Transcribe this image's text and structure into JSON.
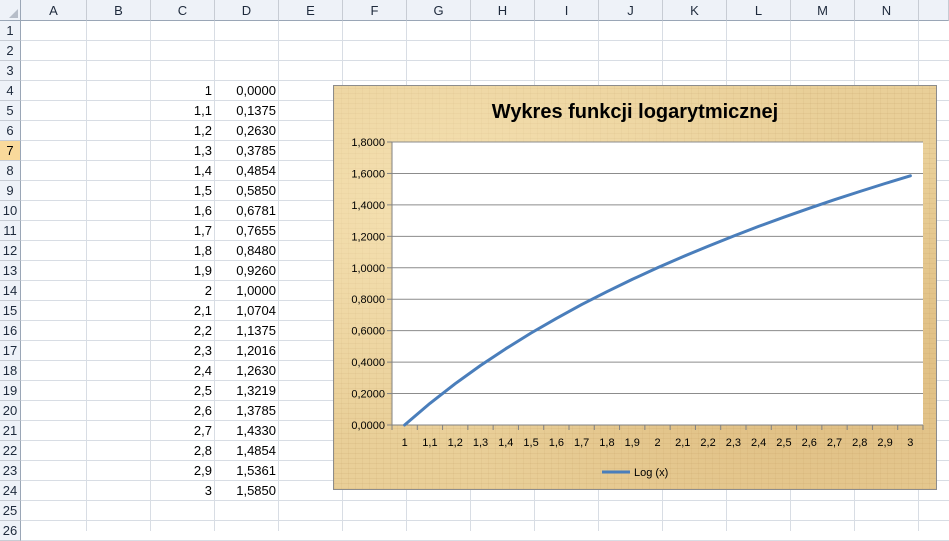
{
  "columns": [
    "A",
    "B",
    "C",
    "D",
    "E",
    "F",
    "G",
    "H",
    "I",
    "J",
    "K",
    "L",
    "M",
    "N"
  ],
  "rows": [
    "1",
    "2",
    "3",
    "4",
    "5",
    "6",
    "7",
    "8",
    "9",
    "10",
    "11",
    "12",
    "13",
    "14",
    "15",
    "16",
    "17",
    "18",
    "19",
    "20",
    "21",
    "22",
    "23",
    "24",
    "25",
    "26"
  ],
  "active_row": "7",
  "table": {
    "c": [
      "1",
      "1,1",
      "1,2",
      "1,3",
      "1,4",
      "1,5",
      "1,6",
      "1,7",
      "1,8",
      "1,9",
      "2",
      "2,1",
      "2,2",
      "2,3",
      "2,4",
      "2,5",
      "2,6",
      "2,7",
      "2,8",
      "2,9",
      "3"
    ],
    "d": [
      "0,0000",
      "0,1375",
      "0,2630",
      "0,3785",
      "0,4854",
      "0,5850",
      "0,6781",
      "0,7655",
      "0,8480",
      "0,9260",
      "1,0000",
      "1,0704",
      "1,1375",
      "1,2016",
      "1,2630",
      "1,3219",
      "1,3785",
      "1,4330",
      "1,4854",
      "1,5361",
      "1,5850"
    ]
  },
  "chart_data": {
    "type": "line",
    "title": "Wykres funkcji logarytmicznej",
    "categories": [
      "1",
      "1,1",
      "1,2",
      "1,3",
      "1,4",
      "1,5",
      "1,6",
      "1,7",
      "1,8",
      "1,9",
      "2",
      "2,1",
      "2,2",
      "2,3",
      "2,4",
      "2,5",
      "2,6",
      "2,7",
      "2,8",
      "2,9",
      "3"
    ],
    "series": [
      {
        "name": "Log (x)",
        "color": "#4a7ebb",
        "values": [
          0.0,
          0.1375,
          0.263,
          0.3785,
          0.4854,
          0.585,
          0.6781,
          0.7655,
          0.848,
          0.926,
          1.0,
          1.0704,
          1.1375,
          1.2016,
          1.263,
          1.3219,
          1.3785,
          1.433,
          1.4854,
          1.5361,
          1.585
        ]
      }
    ],
    "ylim": [
      0,
      1.8
    ],
    "yticks": [
      "0,0000",
      "0,2000",
      "0,4000",
      "0,6000",
      "0,8000",
      "1,0000",
      "1,2000",
      "1,4000",
      "1,6000",
      "1,8000"
    ],
    "grid": true,
    "legend": "bottom"
  }
}
